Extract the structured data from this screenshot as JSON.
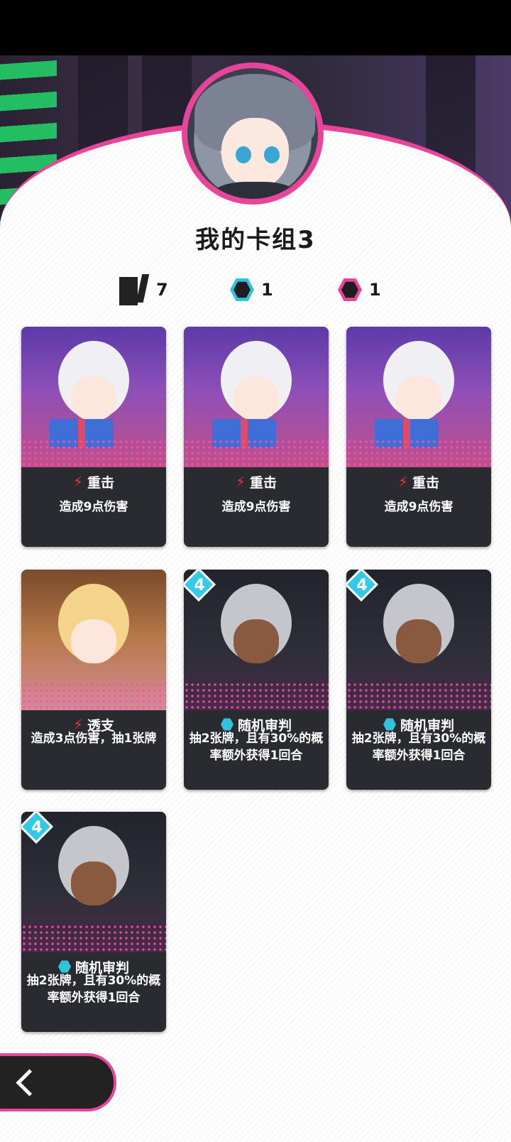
{
  "deck": {
    "title": "我的卡组3",
    "card_count": "7",
    "cyan_count": "1",
    "pink_count": "1"
  },
  "cards": [
    {
      "name": "重击",
      "desc": "造成9点伤害",
      "type": "attack",
      "art": "purple"
    },
    {
      "name": "重击",
      "desc": "造成9点伤害",
      "type": "attack",
      "art": "purple"
    },
    {
      "name": "重击",
      "desc": "造成9点伤害",
      "type": "attack",
      "art": "purple"
    },
    {
      "name": "透支",
      "desc": "造成3点伤害，抽1张牌",
      "type": "attack",
      "art": "wood"
    },
    {
      "name": "随机审判",
      "desc": "抽2张牌，且有30%的概率额外获得1回合",
      "type": "skill",
      "art": "dark",
      "cost": "4"
    },
    {
      "name": "随机审判",
      "desc": "抽2张牌，且有30%的概率额外获得1回合",
      "type": "skill",
      "art": "dark",
      "cost": "4"
    },
    {
      "name": "随机审判",
      "desc": "抽2张牌，且有30%的概率额外获得1回合",
      "type": "skill",
      "art": "dark",
      "cost": "4"
    }
  ],
  "colors": {
    "accent": "#e8449a",
    "cyan": "#2fc4dc",
    "attack": "#ff2a3a"
  },
  "icons": {
    "back": "chevron-left-icon"
  }
}
